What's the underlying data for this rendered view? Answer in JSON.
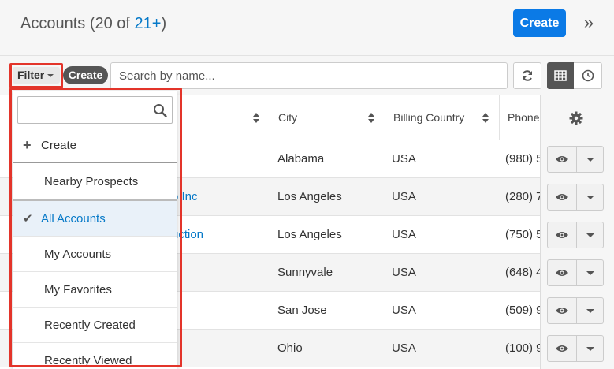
{
  "header": {
    "title_prefix": "Accounts (20 of ",
    "title_count": "21+",
    "title_suffix": ")",
    "create_label": "Create",
    "collapse_glyph": "»"
  },
  "filterbar": {
    "filter_label": "Filter",
    "create_label": "Create",
    "search_placeholder": "Search by name..."
  },
  "table": {
    "columns": [
      "City",
      "Billing Country",
      "Phone"
    ],
    "rows": [
      {
        "name": "",
        "city": "Alabama",
        "country": "USA",
        "phone": "(980) 5"
      },
      {
        "name": "o Inc",
        "city": "Los Angeles",
        "country": "USA",
        "phone": "(280) 7"
      },
      {
        "name": "uction",
        "city": "Los Angeles",
        "country": "USA",
        "phone": "(750) 5"
      },
      {
        "name": "",
        "city": "Sunnyvale",
        "country": "USA",
        "phone": "(648) 4"
      },
      {
        "name": "",
        "city": "San Jose",
        "country": "USA",
        "phone": "(509) 9"
      },
      {
        "name": "",
        "city": "Ohio",
        "country": "USA",
        "phone": "(100) 9"
      }
    ]
  },
  "dropdown": {
    "create_label": "Create",
    "items": [
      "Nearby Prospects",
      "All Accounts",
      "My Accounts",
      "My Favorites",
      "Recently Created",
      "Recently Viewed"
    ],
    "selected": "All Accounts"
  },
  "colors": {
    "accent": "#0b7ae6",
    "link": "#0679c8",
    "highlight": "#e3342a"
  },
  "icons": {
    "collapse": "double-chevron-right-icon",
    "refresh": "refresh-icon",
    "table": "table-view-icon",
    "history": "clock-icon",
    "settings": "gear-icon",
    "search": "search-icon",
    "preview": "eye-icon"
  }
}
